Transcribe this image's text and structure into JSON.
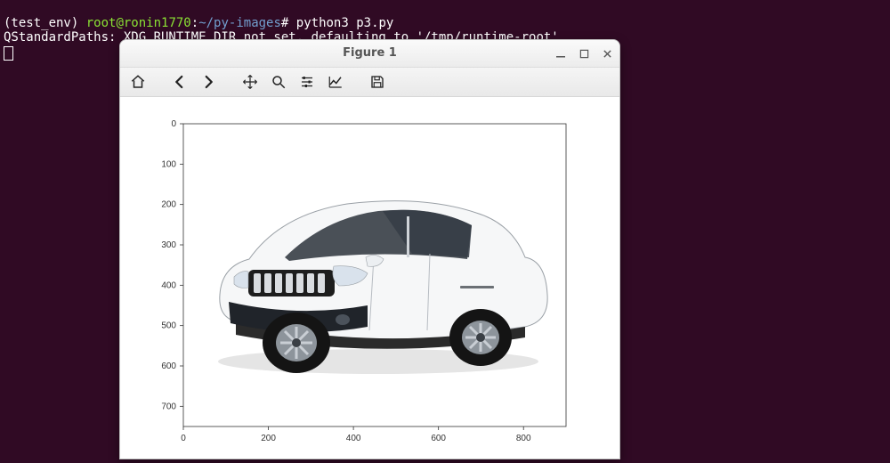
{
  "terminal": {
    "prompt_env": "(test_env)",
    "prompt_userhost": "root@ronin1770",
    "prompt_colon": ":",
    "prompt_path": "~/py-images",
    "prompt_hash": "#",
    "command": "python3 p3.py",
    "warning": "QStandardPaths: XDG_RUNTIME_DIR not set, defaulting to '/tmp/runtime-root'"
  },
  "window": {
    "title": "Figure 1",
    "controls": {
      "minimize_icon": "minimize-icon",
      "maximize_icon": "maximize-icon",
      "close_icon": "close-icon"
    }
  },
  "toolbar": {
    "home_title": "Home",
    "back_title": "Back",
    "forward_title": "Forward",
    "pan_title": "Pan",
    "zoom_title": "Zoom",
    "configure_title": "Configure subplots",
    "edit_title": "Edit axis",
    "save_title": "Save"
  },
  "chart_data": {
    "type": "image",
    "description": "matplotlib imshow of a white SUV photograph on white background",
    "x_ticks": [
      0,
      200,
      400,
      600,
      800
    ],
    "y_ticks": [
      0,
      100,
      200,
      300,
      400,
      500,
      600,
      700
    ],
    "xlim": [
      0,
      900
    ],
    "ylim": [
      750,
      0
    ],
    "xlabel": "",
    "ylabel": "",
    "title": ""
  }
}
